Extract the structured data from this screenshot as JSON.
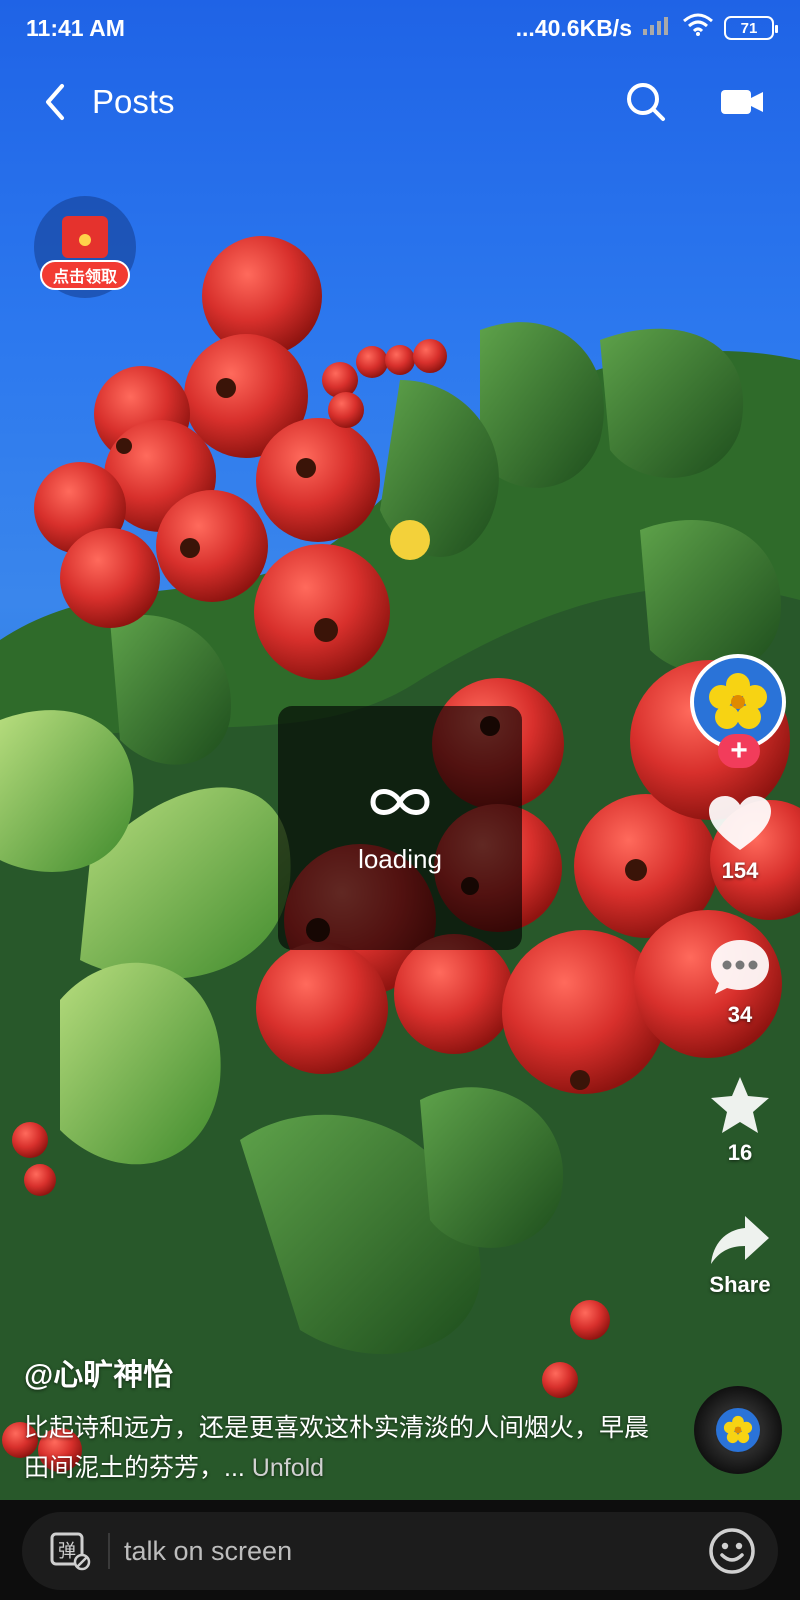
{
  "status_bar": {
    "time": "11:41 AM",
    "network_speed": "...40.6KB/s",
    "battery": "71"
  },
  "nav": {
    "title": "Posts"
  },
  "red_packet": {
    "label": "点击领取"
  },
  "loading": {
    "text": "loading"
  },
  "actions": {
    "likes": "154",
    "comments": "34",
    "favorites": "16",
    "share": "Share"
  },
  "caption": {
    "author": "@心旷神怡",
    "text": "比起诗和远方，还是更喜欢这朴实清淡的人间烟火，早晨田间泥土的芬芳，...",
    "unfold": "Unfold"
  },
  "comment_bar": {
    "placeholder": "talk on screen",
    "danmaku_icon_text": "弹"
  },
  "colors": {
    "sky": "#2c78ee",
    "follow_button": "#f23c5b",
    "red_packet": "#f23b32",
    "berry": "#d8302c"
  }
}
